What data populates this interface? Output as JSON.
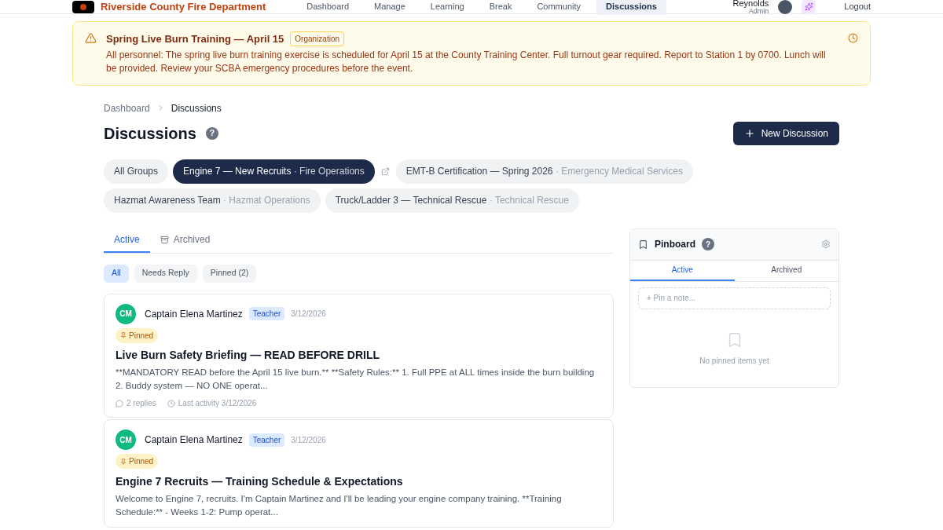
{
  "header": {
    "brand": "Riverside County Fire Department",
    "nav": [
      {
        "label": "Dashboard",
        "selected": false
      },
      {
        "label": "Manage",
        "selected": false
      },
      {
        "label": "Learning",
        "selected": false
      },
      {
        "label": "Break",
        "selected": false
      },
      {
        "label": "Community",
        "selected": false
      },
      {
        "label": "Discussions",
        "selected": true
      }
    ],
    "user": {
      "name": "Reynolds",
      "role": "Admin"
    },
    "logout": "Logout"
  },
  "announcement": {
    "title": "Spring Live Burn Training — April 15",
    "tag": "Organization",
    "body": "All personnel: The spring live burn training exercise is scheduled for April 15 at the County Training Center. Full turnout gear required. Report to Station 1 by 0700. Lunch will be provided. Review your SCBA emergency procedures before the event."
  },
  "breadcrumb": [
    "Dashboard",
    "Discussions"
  ],
  "page_title": "Discussions",
  "help": "?",
  "new_button": "New Discussion",
  "groups": [
    {
      "name": "All Groups",
      "selected": false
    },
    {
      "name": "Engine 7 — New Recruits",
      "category": "· Fire Operations",
      "selected": true
    },
    {
      "name": "EMT-B Certification — Spring 2026",
      "category": "· Emergency Medical Services",
      "selected": false
    },
    {
      "name": "Hazmat Awareness Team",
      "category": "· Hazmat Operations",
      "selected": false
    },
    {
      "name": "Truck/Ladder 3 — Technical Rescue",
      "category": "· Technical Rescue",
      "selected": false
    }
  ],
  "tabs": [
    {
      "label": "Active",
      "selected": true
    },
    {
      "label": "Archived",
      "selected": false
    }
  ],
  "filters": [
    {
      "label": "All",
      "selected": true
    },
    {
      "label": "Needs Reply",
      "selected": false
    },
    {
      "label": "Pinned (2)",
      "selected": false
    }
  ],
  "posts": [
    {
      "initials": "CM",
      "author": "Captain Elena Martinez",
      "role": "Teacher",
      "date": "3/12/2026",
      "pinned": true,
      "pin_label": "Pinned",
      "title": "Live Burn Safety Briefing — READ BEFORE DRILL",
      "excerpt": "**MANDATORY READ before the April 15 live burn.** **Safety Rules:** 1. Full PPE at ALL times inside the burn building 2. Buddy system — NO ONE operat...",
      "replies": "2 replies",
      "activity": "Last activity 3/12/2026"
    },
    {
      "initials": "CM",
      "author": "Captain Elena Martinez",
      "role": "Teacher",
      "date": "3/12/2026",
      "pinned": true,
      "pin_label": "Pinned",
      "title": "Engine 7 Recruits — Training Schedule & Expectations",
      "excerpt": "Welcome to Engine 7, recruits. I'm Captain Martinez and I'll be leading your engine company training. **Training Schedule:** - Weeks 1-2: Pump operat..."
    }
  ],
  "pinboard": {
    "title": "Pinboard",
    "help": "?",
    "tabs": [
      {
        "label": "Active",
        "selected": true
      },
      {
        "label": "Archived",
        "selected": false
      }
    ],
    "placeholder": "+ Pin a note...",
    "empty": "No pinned items yet"
  }
}
